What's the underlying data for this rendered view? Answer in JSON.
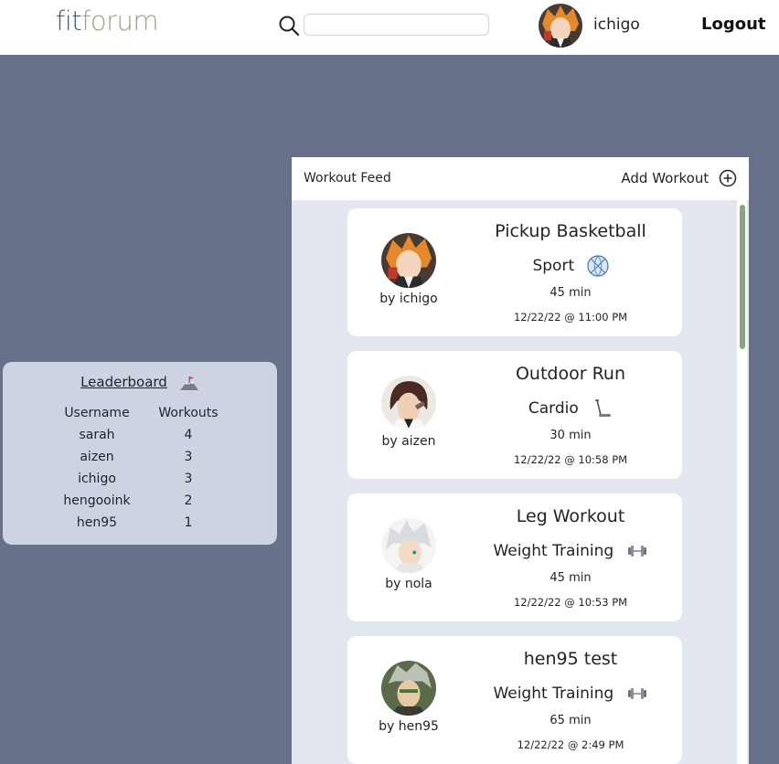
{
  "header": {
    "logo_fit": "fit",
    "logo_forum": "forum",
    "search": {
      "value": "",
      "placeholder": ""
    },
    "username": "ichigo",
    "logout_label": "Logout"
  },
  "leaderboard": {
    "title": "Leaderboard",
    "columns": [
      "Username",
      "Workouts"
    ],
    "rows": [
      {
        "username": "sarah",
        "workouts": "4"
      },
      {
        "username": "aizen",
        "workouts": "3"
      },
      {
        "username": "ichigo",
        "workouts": "3"
      },
      {
        "username": "hengooink",
        "workouts": "2"
      },
      {
        "username": "hen95",
        "workouts": "1"
      }
    ]
  },
  "feed": {
    "title": "Workout Feed",
    "add_label": "Add Workout",
    "workouts": [
      {
        "title": "Pickup Basketball",
        "type": "Sport",
        "type_icon": "basketball-icon",
        "duration": "45 min",
        "date": "12/22/22 @ 11:00 PM",
        "by": "by ichigo"
      },
      {
        "title": "Outdoor Run",
        "type": "Cardio",
        "type_icon": "treadmill-icon",
        "duration": "30 min",
        "date": "12/22/22 @ 10:58 PM",
        "by": "by aizen"
      },
      {
        "title": "Leg Workout",
        "type": "Weight Training",
        "type_icon": "dumbbell-icon",
        "duration": "45 min",
        "date": "12/22/22 @ 10:53 PM",
        "by": "by nola"
      },
      {
        "title": "hen95 test",
        "type": "Weight Training",
        "type_icon": "dumbbell-icon",
        "duration": "65 min",
        "date": "12/22/22 @ 2:49 PM",
        "by": "by hen95"
      }
    ]
  },
  "colors": {
    "background": "#67718a",
    "logo_fit": "#3f5a7a",
    "logo_forum": "#94a77e",
    "leaderboard_bg": "#cdd3e0",
    "feed_bg": "#e2e7f0",
    "scrollbar": "#8aa380"
  }
}
